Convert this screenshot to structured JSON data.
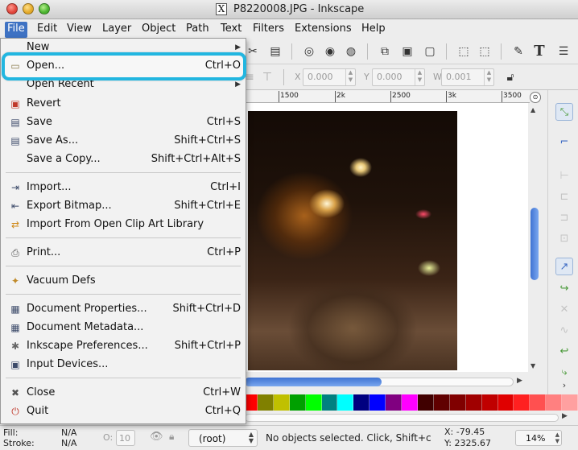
{
  "window": {
    "title": "P8220008.JPG - Inkscape",
    "title_glyph": "X"
  },
  "menubar": [
    "File",
    "Edit",
    "View",
    "Layer",
    "Object",
    "Path",
    "Text",
    "Filters",
    "Extensions",
    "Help"
  ],
  "file_menu": {
    "new": "New",
    "open": {
      "label": "Open...",
      "shortcut": "Ctrl+O"
    },
    "open_recent": "Open Recent",
    "revert": {
      "label": "Revert"
    },
    "save": {
      "label": "Save",
      "shortcut": "Ctrl+S"
    },
    "save_as": {
      "label": "Save As...",
      "shortcut": "Shift+Ctrl+S"
    },
    "save_copy": {
      "label": "Save a Copy...",
      "shortcut": "Shift+Ctrl+Alt+S"
    },
    "import": {
      "label": "Import...",
      "shortcut": "Ctrl+I"
    },
    "export_bitmap": {
      "label": "Export Bitmap...",
      "shortcut": "Shift+Ctrl+E"
    },
    "import_clipart": {
      "label": "Import From Open Clip Art Library"
    },
    "print": {
      "label": "Print...",
      "shortcut": "Ctrl+P"
    },
    "vacuum": {
      "label": "Vacuum Defs"
    },
    "doc_props": {
      "label": "Document Properties...",
      "shortcut": "Shift+Ctrl+D"
    },
    "doc_meta": {
      "label": "Document Metadata..."
    },
    "prefs": {
      "label": "Inkscape Preferences...",
      "shortcut": "Shift+Ctrl+P"
    },
    "input_devices": {
      "label": "Input Devices..."
    },
    "close": {
      "label": "Close",
      "shortcut": "Ctrl+W"
    },
    "quit": {
      "label": "Quit",
      "shortcut": "Ctrl+Q"
    }
  },
  "toolbar2": {
    "x_label": "X",
    "x_value": "0.000",
    "y_label": "Y",
    "y_value": "0.000",
    "w_label": "W",
    "w_value": "0.001"
  },
  "ruler": [
    "1500",
    "2k",
    "2500",
    "3k",
    "3500"
  ],
  "palette_colors": [
    "#ff0000",
    "#808000",
    "#c0c000",
    "#00a000",
    "#00ff00",
    "#008080",
    "#00ffff",
    "#000080",
    "#0000ff",
    "#800080",
    "#ff00ff",
    "#400000",
    "#600000",
    "#800000",
    "#a00000",
    "#c00000",
    "#e00000",
    "#ff2020",
    "#ff5050",
    "#ff8080",
    "#ffa0a0"
  ],
  "status": {
    "fill_label": "Fill:",
    "fill_value": "N/A",
    "stroke_label": "Stroke:",
    "stroke_value": "N/A",
    "opacity_label": "O:",
    "opacity_value": "10",
    "layer": "(root)",
    "message": "No objects selected. Click, Shift+c",
    "x_coord": "X:   -79.45",
    "y_coord": "Y: 2325.67",
    "zoom": "14%"
  }
}
